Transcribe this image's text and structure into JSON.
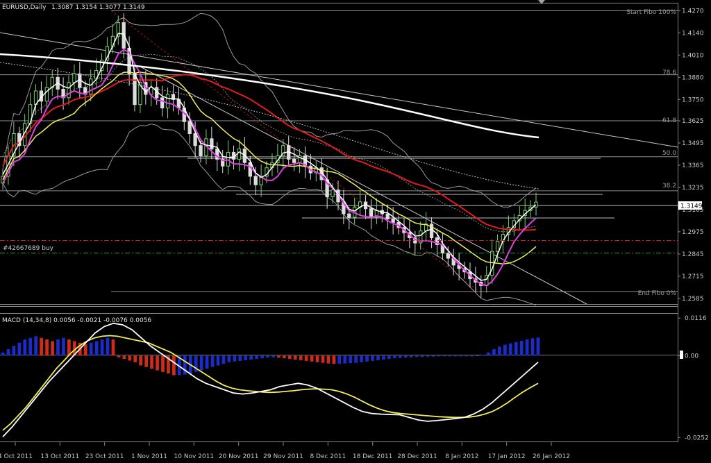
{
  "header": {
    "symbol_tf": "EURUSD,Daily",
    "ohlc": "1.3087 1.3154 1.3077 1.3149"
  },
  "macd_header": "MACD (14,34,8) 0.0056 -0.0021 -0.0076 0.0056",
  "order_label": "#42667689 buy",
  "current_price_tag": "1.3149",
  "fibo_labels": {
    "start": "Start  Fibo 100%",
    "f786": "78.6",
    "f618": "61.8",
    "f500": "50.0",
    "f382": "38.2",
    "end": "End  Fibo  0%"
  },
  "colors": {
    "background": "#000000",
    "bull_candle": "#7bd36a",
    "bear_candle": "#dcdcdc",
    "ma_red": "#e21c1c",
    "ma_yellow": "#f2ee5a",
    "ma_white": "#ffffff",
    "ma_magenta": "#e040e0",
    "macd_hist_pos": "#1c2cc8",
    "macd_hist_neg": "#d02a1a",
    "order_line": "#cc2020",
    "stop_line": "#28a028"
  },
  "chart_data": [
    {
      "type": "line",
      "title": "EURUSD,Daily",
      "x_tick_labels": [
        "4 Oct 2011",
        "13 Oct 2011",
        "23 Oct 2011",
        "1 Nov 2011",
        "10 Nov 2011",
        "20 Nov 2011",
        "29 Nov 2011",
        "8 Dec 2011",
        "18 Dec 2011",
        "28 Dec 2011",
        "8 Jan 2012",
        "17 Jan 2012",
        "26 Jan 2012"
      ],
      "y_tick_labels": [
        "1.4270",
        "1.4140",
        "1.4010",
        "1.3880",
        "1.3750",
        "1.3625",
        "1.3495",
        "1.3365",
        "1.3235",
        "1.3105",
        "1.2975",
        "1.2845",
        "1.2715",
        "1.2585"
      ],
      "ylim": [
        1.256,
        1.43
      ],
      "price_close": [
        1.33,
        1.342,
        1.355,
        1.348,
        1.361,
        1.372,
        1.38,
        1.374,
        1.382,
        1.388,
        1.381,
        1.376,
        1.385,
        1.39,
        1.382,
        1.378,
        1.387,
        1.392,
        1.398,
        1.406,
        1.412,
        1.42,
        1.405,
        1.39,
        1.372,
        1.385,
        1.378,
        1.382,
        1.376,
        1.37,
        1.378,
        1.375,
        1.37,
        1.362,
        1.355,
        1.348,
        1.342,
        1.352,
        1.346,
        1.34,
        1.336,
        1.344,
        1.34,
        1.346,
        1.338,
        1.33,
        1.325,
        1.33,
        1.335,
        1.338,
        1.342,
        1.348,
        1.34,
        1.338,
        1.342,
        1.336,
        1.332,
        1.335,
        1.328,
        1.318,
        1.322,
        1.315,
        1.308,
        1.306,
        1.312,
        1.315,
        1.311,
        1.306,
        1.31,
        1.308,
        1.305,
        1.303,
        1.3,
        1.297,
        1.294,
        1.291,
        1.298,
        1.302,
        1.294,
        1.29,
        1.285,
        1.282,
        1.278,
        1.276,
        1.274,
        1.27,
        1.268,
        1.266,
        1.272,
        1.286,
        1.292,
        1.296,
        1.3,
        1.304,
        1.307,
        1.31,
        1.312,
        1.3149
      ],
      "fibo_levels": {
        "100": 1.427,
        "78.6": 1.3895,
        "61.8": 1.3625,
        "50.0": 1.3415,
        "38.2": 1.3215,
        "0": 1.2625
      },
      "order_price": 1.294,
      "stop_price": 1.287
    },
    {
      "type": "bar",
      "title": "MACD (14,34,8)",
      "y_tick_labels": [
        "0.0116",
        "0.00",
        "-0.0252"
      ],
      "ylim": [
        -0.026,
        0.0125
      ],
      "histogram": [
        0.001,
        0.002,
        0.003,
        0.004,
        0.005,
        0.0055,
        0.006,
        0.0055,
        0.005,
        0.0045,
        0.005,
        0.0055,
        0.005,
        0.0045,
        0.004,
        0.0035,
        0.004,
        0.0045,
        0.005,
        0.0055,
        0.005,
        -0.0005,
        -0.001,
        -0.0015,
        -0.002,
        -0.003,
        -0.0035,
        -0.004,
        -0.0045,
        -0.005,
        -0.0055,
        -0.006,
        -0.006,
        -0.0058,
        -0.0055,
        -0.005,
        -0.0045,
        -0.004,
        -0.0035,
        -0.003,
        -0.0025,
        -0.002,
        -0.0018,
        -0.0016,
        -0.0014,
        -0.0012,
        -0.001,
        -0.0008,
        -0.0006,
        -0.0005,
        -0.0006,
        -0.0008,
        -0.001,
        -0.0012,
        -0.0014,
        -0.0016,
        -0.0018,
        -0.002,
        -0.0022,
        -0.0024,
        -0.0025,
        -0.0025,
        -0.0024,
        -0.0023,
        -0.0022,
        -0.002,
        -0.0018,
        -0.0016,
        -0.0014,
        -0.0012,
        -0.001,
        -0.0008,
        -0.0007,
        -0.0006,
        -0.0005,
        -0.0004,
        -0.0004,
        -0.0003,
        -0.0003,
        -0.0002,
        -0.0002,
        -0.0002,
        -0.0002,
        -0.0001,
        -0.0001,
        0.0,
        0.0001,
        0.0003,
        0.001,
        0.002,
        0.0028,
        0.0034,
        0.0038,
        0.0042,
        0.0046,
        0.005,
        0.0054,
        0.0056
      ],
      "signal": [
        -0.023,
        -0.021,
        -0.0185,
        -0.016,
        -0.013,
        -0.01,
        -0.007,
        -0.004,
        -0.0015,
        0.001,
        0.003,
        0.0045,
        0.0055,
        0.006,
        0.0062,
        0.006,
        0.0055,
        0.005,
        0.0045,
        0.004,
        0.003,
        0.002,
        0.001,
        -0.0005,
        -0.002,
        -0.0035,
        -0.005,
        -0.0065,
        -0.008,
        -0.0092,
        -0.01,
        -0.0105,
        -0.0108,
        -0.011,
        -0.0112,
        -0.0113,
        -0.0112,
        -0.011,
        -0.0108,
        -0.0105,
        -0.0103,
        -0.0102,
        -0.0103,
        -0.0105,
        -0.011,
        -0.0118,
        -0.0128,
        -0.014,
        -0.0152,
        -0.0162,
        -0.017,
        -0.0175,
        -0.0178,
        -0.018,
        -0.0182,
        -0.0184,
        -0.0186,
        -0.0188,
        -0.0189,
        -0.019,
        -0.019,
        -0.0189,
        -0.0186,
        -0.018,
        -0.0172,
        -0.016,
        -0.0145,
        -0.0128,
        -0.0112,
        -0.0098,
        -0.0085
      ],
      "macd": [
        -0.025,
        -0.022,
        -0.0185,
        -0.015,
        -0.0115,
        -0.008,
        -0.005,
        -0.002,
        0.001,
        0.004,
        0.007,
        0.009,
        0.01,
        0.0095,
        0.008,
        0.0055,
        0.003,
        0.001,
        -0.001,
        -0.003,
        -0.005,
        -0.007,
        -0.0085,
        -0.0095,
        -0.0105,
        -0.0115,
        -0.0118,
        -0.0115,
        -0.011,
        -0.0105,
        -0.0095,
        -0.009,
        -0.0085,
        -0.009,
        -0.01,
        -0.0115,
        -0.013,
        -0.0145,
        -0.016,
        -0.0172,
        -0.0178,
        -0.018,
        -0.0181,
        -0.0182,
        -0.019,
        -0.0198,
        -0.0202,
        -0.02,
        -0.0197,
        -0.0194,
        -0.019,
        -0.018,
        -0.0165,
        -0.0145,
        -0.012,
        -0.0095,
        -0.007,
        -0.0045,
        -0.002
      ]
    }
  ]
}
